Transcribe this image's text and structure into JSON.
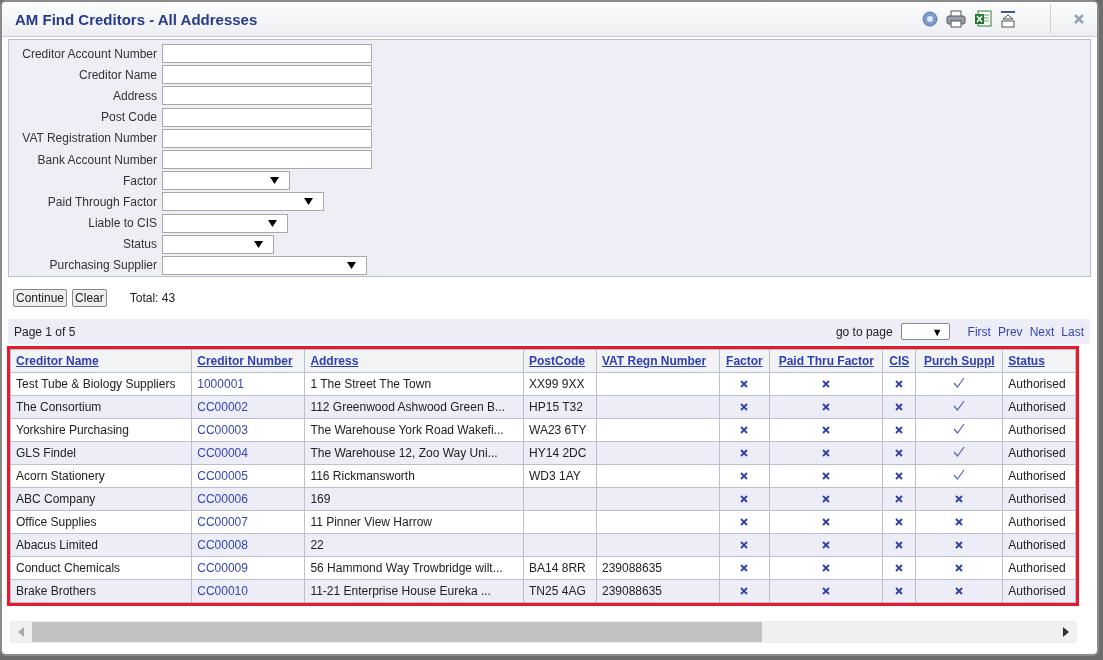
{
  "window": {
    "title": "AM Find Creditors - All Addresses"
  },
  "search_form": {
    "fields": [
      {
        "label": "Creditor Account Number",
        "kind": "text"
      },
      {
        "label": "Creditor Name",
        "kind": "text"
      },
      {
        "label": "Address",
        "kind": "text"
      },
      {
        "label": "Post Code",
        "kind": "text"
      },
      {
        "label": "VAT Registration Number",
        "kind": "text"
      },
      {
        "label": "Bank Account Number",
        "kind": "text"
      },
      {
        "label": "Factor",
        "kind": "select"
      },
      {
        "label": "Paid Through Factor",
        "kind": "select"
      },
      {
        "label": "Liable to CIS",
        "kind": "select"
      },
      {
        "label": "Status",
        "kind": "select"
      },
      {
        "label": "Purchasing Supplier",
        "kind": "select"
      }
    ]
  },
  "actions": {
    "buttons": [
      "Continue",
      "Clear"
    ],
    "total": "Total: 43"
  },
  "pager": {
    "page_info": "Page 1 of 5",
    "go_to_label": "go to page",
    "dropdown_arrow": "▼",
    "links": [
      "First",
      "Prev",
      "Next",
      "Last"
    ]
  },
  "table": {
    "columns": [
      "Creditor Name",
      "Creditor Number",
      "Address",
      "PostCode",
      "VAT Regn Number",
      "Factor",
      "Paid Thru Factor",
      "CIS",
      "Purch Suppl",
      "Status"
    ],
    "rows": [
      {
        "name": "Test Tube & Biology Suppliers",
        "number": "1000001",
        "address": "1 The Street The Town",
        "postcode": "XX99 9XX",
        "vat": "",
        "factor": false,
        "paid_thru_factor": false,
        "cis": false,
        "purch_suppl": true,
        "status": "Authorised"
      },
      {
        "name": "The Consortium",
        "number": "CC00002",
        "address": "112 Greenwood Ashwood Green B...",
        "postcode": "HP15 T32",
        "vat": "",
        "factor": false,
        "paid_thru_factor": false,
        "cis": false,
        "purch_suppl": true,
        "status": "Authorised"
      },
      {
        "name": "Yorkshire Purchasing",
        "number": "CC00003",
        "address": "The Warehouse York Road Wakefi...",
        "postcode": "WA23 6TY",
        "vat": "",
        "factor": false,
        "paid_thru_factor": false,
        "cis": false,
        "purch_suppl": true,
        "status": "Authorised"
      },
      {
        "name": "GLS Findel",
        "number": "CC00004",
        "address": "The Warehouse 12, Zoo Way Uni...",
        "postcode": "HY14 2DC",
        "vat": "",
        "factor": false,
        "paid_thru_factor": false,
        "cis": false,
        "purch_suppl": true,
        "status": "Authorised"
      },
      {
        "name": "Acorn Stationery",
        "number": "CC00005",
        "address": "116 Rickmansworth",
        "postcode": "WD3 1AY",
        "vat": "",
        "factor": false,
        "paid_thru_factor": false,
        "cis": false,
        "purch_suppl": true,
        "status": "Authorised"
      },
      {
        "name": "ABC Company",
        "number": "CC00006",
        "address": "169",
        "postcode": "",
        "vat": "",
        "factor": false,
        "paid_thru_factor": false,
        "cis": false,
        "purch_suppl": false,
        "status": "Authorised"
      },
      {
        "name": "Office Supplies",
        "number": "CC00007",
        "address": "11 Pinner View Harrow",
        "postcode": "",
        "vat": "",
        "factor": false,
        "paid_thru_factor": false,
        "cis": false,
        "purch_suppl": false,
        "status": "Authorised"
      },
      {
        "name": "Abacus Limited",
        "number": "CC00008",
        "address": "22",
        "postcode": "",
        "vat": "",
        "factor": false,
        "paid_thru_factor": false,
        "cis": false,
        "purch_suppl": false,
        "status": "Authorised"
      },
      {
        "name": "Conduct Chemicals",
        "number": "CC00009",
        "address": "56 Hammond Way Trowbridge wilt...",
        "postcode": "BA14 8RR",
        "vat": "239088635",
        "factor": false,
        "paid_thru_factor": false,
        "cis": false,
        "purch_suppl": false,
        "status": "Authorised"
      },
      {
        "name": "Brake Brothers",
        "number": "CC00010",
        "address": "11-21 Enterprise House Eureka ...",
        "postcode": "TN25 4AG",
        "vat": "239088635",
        "factor": false,
        "paid_thru_factor": false,
        "cis": false,
        "purch_suppl": false,
        "status": "Authorised"
      }
    ]
  }
}
